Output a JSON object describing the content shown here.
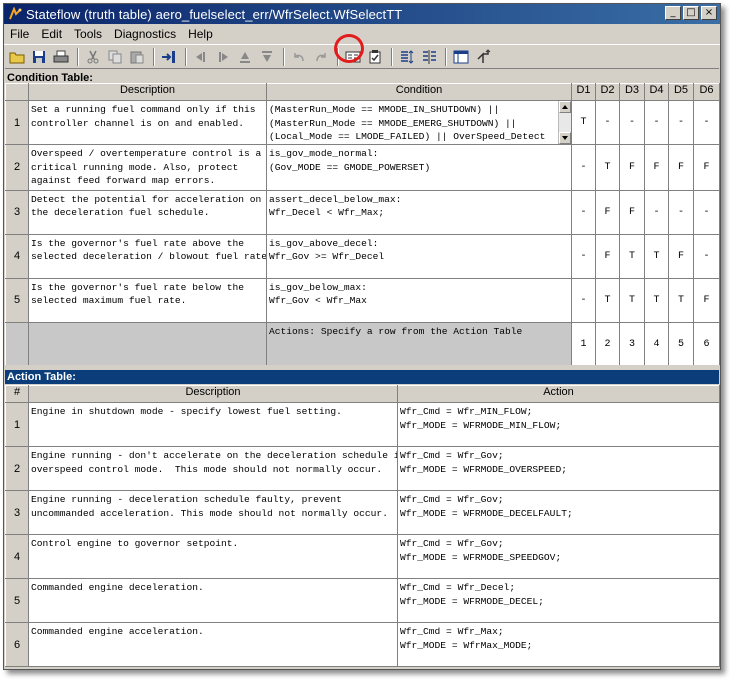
{
  "window": {
    "title": "Stateflow (truth table) aero_fuelselect_err/WfrSelect.WfSelectTT",
    "minimize": "_",
    "maximize": "□",
    "close": "×"
  },
  "menu": [
    "File",
    "Edit",
    "Tools",
    "Diagnostics",
    "Help"
  ],
  "toolbar_icons": [
    "open-icon",
    "save-icon",
    "print-icon",
    "cut-icon",
    "copy-icon",
    "paste-icon",
    "insert-row-icon",
    "move-left-icon",
    "move-right-icon",
    "move-up-icon",
    "move-down-icon",
    "undo-icon",
    "redo-icon",
    "edit-data-icon",
    "run-diagnostics-icon",
    "append-row-icon",
    "append-column-icon",
    "table-view-icon",
    "go-to-parent-icon"
  ],
  "condition_table": {
    "label": "Condition Table:",
    "headers": {
      "num": "",
      "description": "Description",
      "condition": "Condition",
      "decisions": [
        "D1",
        "D2",
        "D3",
        "D4",
        "D5",
        "D6"
      ]
    },
    "rows": [
      {
        "num": "1",
        "description": "Set a running fuel command only if this\ncontroller channel is on and enabled.",
        "condition": "(MasterRun_Mode == MMODE_IN_SHUTDOWN) ||\n(MasterRun_Mode == MMODE_EMERG_SHUTDOWN) ||\n(Local_Mode == LMODE_FAILED) || OverSpeed_Detect",
        "d": [
          "T",
          "-",
          "-",
          "-",
          "-",
          "-"
        ]
      },
      {
        "num": "2",
        "description": "Overspeed / overtemperature control is a\ncritical running mode. Also, protect\nagainst feed forward map errors.",
        "condition": "is_gov_mode_normal:\n(Gov_MODE == GMODE_POWERSET)",
        "d": [
          "-",
          "T",
          "F",
          "F",
          "F",
          "F"
        ]
      },
      {
        "num": "3",
        "description": "Detect the potential for acceleration on\nthe deceleration fuel schedule.",
        "condition": "assert_decel_below_max:\nWfr_Decel < Wfr_Max;",
        "d": [
          "-",
          "F",
          "F",
          "-",
          "-",
          "-"
        ]
      },
      {
        "num": "4",
        "description": "Is the governor's fuel rate above the\nselected deceleration / blowout fuel rate?",
        "condition": "is_gov_above_decel:\nWfr_Gov >= Wfr_Decel",
        "d": [
          "-",
          "F",
          "T",
          "T",
          "F",
          "-"
        ]
      },
      {
        "num": "5",
        "description": "Is the governor's fuel rate below the\nselected maximum fuel rate.",
        "condition": "is_gov_below_max:\nWfr_Gov < Wfr_Max",
        "d": [
          "-",
          "T",
          "T",
          "T",
          "T",
          "F"
        ]
      }
    ],
    "actions_row": {
      "label": "Actions: Specify a row from the Action Table",
      "values": [
        "1",
        "2",
        "3",
        "4",
        "5",
        "6"
      ]
    }
  },
  "action_table": {
    "label": "Action Table:",
    "headers": {
      "num": "#",
      "description": "Description",
      "action": "Action"
    },
    "rows": [
      {
        "num": "1",
        "description": "Engine in shutdown mode - specify lowest fuel setting.",
        "action": "Wfr_Cmd = Wfr_MIN_FLOW;\nWfr_MODE = WFRMODE_MIN_FLOW;"
      },
      {
        "num": "2",
        "description": "Engine running - don't accelerate on the deceleration schedule in\noverspeed control mode.  This mode should not normally occur.",
        "action": "Wfr_Cmd = Wfr_Gov;\nWfr_MODE = WFRMODE_OVERSPEED;"
      },
      {
        "num": "3",
        "description": "Engine running - deceleration schedule faulty, prevent\nuncommanded acceleration. This mode should not normally occur.",
        "action": "Wfr_Cmd = Wfr_Gov;\nWfr_MODE = WFRMODE_DECELFAULT;"
      },
      {
        "num": "4",
        "description": "Control engine to governor setpoint.",
        "action": "Wfr_Cmd = Wfr_Gov;\nWfr_MODE = WFRMODE_SPEEDGOV;"
      },
      {
        "num": "5",
        "description": "Commanded engine deceleration.",
        "action": "Wfr_Cmd = Wfr_Decel;\nWfr_MODE = WFRMODE_DECEL;"
      },
      {
        "num": "6",
        "description": "Commanded engine acceleration.",
        "action": "Wfr_Cmd = Wfr_Max;\nWfr_MODE = WfrMax_MODE;"
      }
    ]
  }
}
